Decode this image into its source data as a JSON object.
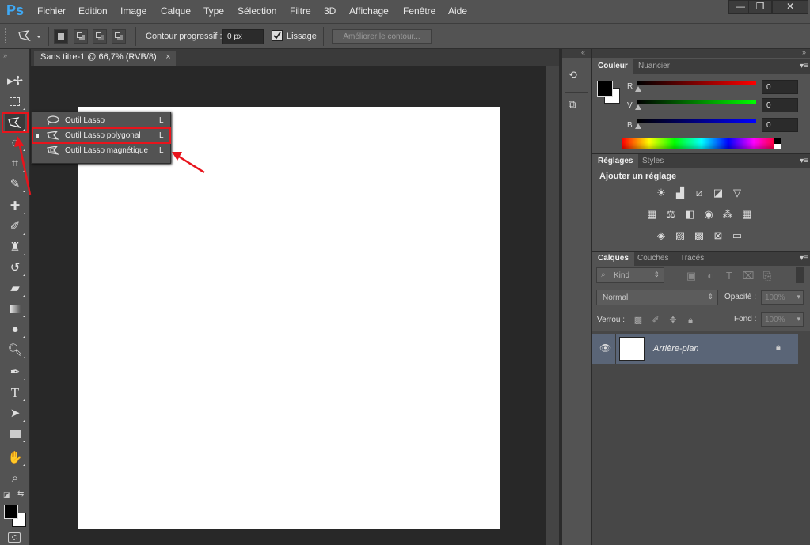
{
  "app": {
    "logo": "Ps"
  },
  "menu": [
    "Fichier",
    "Edition",
    "Image",
    "Calque",
    "Type",
    "Sélection",
    "Filtre",
    "3D",
    "Affichage",
    "Fenêtre",
    "Aide"
  ],
  "window_controls": {
    "minimize": "—",
    "restore": "❐",
    "close": "✕"
  },
  "options": {
    "feather_label": "Contour progressif :",
    "feather_value": "0 px",
    "antialias_label": "Lissage",
    "antialias_checked": true,
    "refine_label": "Améliorer le contour..."
  },
  "document": {
    "tab_title": "Sans titre-1 @ 66,7% (RVB/8)",
    "close": "×"
  },
  "flyout": {
    "items": [
      {
        "label": "Outil Lasso",
        "key": "L",
        "icon": "lasso-icon",
        "selected": false
      },
      {
        "label": "Outil Lasso polygonal",
        "key": "L",
        "icon": "polygonal-lasso-icon",
        "selected": true
      },
      {
        "label": "Outil Lasso magnétique",
        "key": "L",
        "icon": "magnetic-lasso-icon",
        "selected": false
      }
    ]
  },
  "color_panel": {
    "tabs": [
      "Couleur",
      "Nuancier"
    ],
    "channels": [
      {
        "label": "R",
        "value": "0",
        "color": "#ff0000"
      },
      {
        "label": "V",
        "value": "0",
        "color": "#00ff00"
      },
      {
        "label": "B",
        "value": "0",
        "color": "#0000ff"
      }
    ]
  },
  "adjustments_panel": {
    "tabs": [
      "Réglages",
      "Styles"
    ],
    "heading": "Ajouter un réglage"
  },
  "layers_panel": {
    "tabs": [
      "Calques",
      "Couches",
      "Tracés"
    ],
    "filter_kind": "Kind",
    "blend_mode": "Normal",
    "opacity_label": "Opacité :",
    "opacity_value": "100%",
    "lock_label": "Verrou :",
    "fill_label": "Fond :",
    "fill_value": "100%",
    "layers": [
      {
        "name": "Arrière-plan",
        "visible": true,
        "locked": true
      }
    ]
  },
  "colors": {
    "accent_blue": "#3fa9f5",
    "highlight_red": "#e8141c",
    "selected_layer": "#5a6577"
  }
}
